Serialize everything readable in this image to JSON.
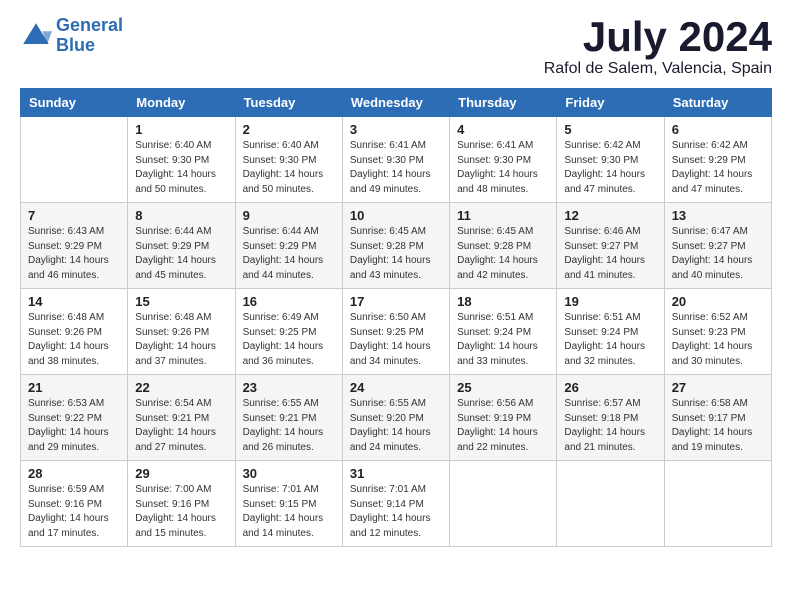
{
  "logo": {
    "line1": "General",
    "line2": "Blue"
  },
  "title": "July 2024",
  "location": "Rafol de Salem, Valencia, Spain",
  "days_of_week": [
    "Sunday",
    "Monday",
    "Tuesday",
    "Wednesday",
    "Thursday",
    "Friday",
    "Saturday"
  ],
  "weeks": [
    [
      {
        "day": "",
        "sunrise": "",
        "sunset": "",
        "daylight": ""
      },
      {
        "day": "1",
        "sunrise": "Sunrise: 6:40 AM",
        "sunset": "Sunset: 9:30 PM",
        "daylight": "Daylight: 14 hours and 50 minutes."
      },
      {
        "day": "2",
        "sunrise": "Sunrise: 6:40 AM",
        "sunset": "Sunset: 9:30 PM",
        "daylight": "Daylight: 14 hours and 50 minutes."
      },
      {
        "day": "3",
        "sunrise": "Sunrise: 6:41 AM",
        "sunset": "Sunset: 9:30 PM",
        "daylight": "Daylight: 14 hours and 49 minutes."
      },
      {
        "day": "4",
        "sunrise": "Sunrise: 6:41 AM",
        "sunset": "Sunset: 9:30 PM",
        "daylight": "Daylight: 14 hours and 48 minutes."
      },
      {
        "day": "5",
        "sunrise": "Sunrise: 6:42 AM",
        "sunset": "Sunset: 9:30 PM",
        "daylight": "Daylight: 14 hours and 47 minutes."
      },
      {
        "day": "6",
        "sunrise": "Sunrise: 6:42 AM",
        "sunset": "Sunset: 9:29 PM",
        "daylight": "Daylight: 14 hours and 47 minutes."
      }
    ],
    [
      {
        "day": "7",
        "sunrise": "Sunrise: 6:43 AM",
        "sunset": "Sunset: 9:29 PM",
        "daylight": "Daylight: 14 hours and 46 minutes."
      },
      {
        "day": "8",
        "sunrise": "Sunrise: 6:44 AM",
        "sunset": "Sunset: 9:29 PM",
        "daylight": "Daylight: 14 hours and 45 minutes."
      },
      {
        "day": "9",
        "sunrise": "Sunrise: 6:44 AM",
        "sunset": "Sunset: 9:29 PM",
        "daylight": "Daylight: 14 hours and 44 minutes."
      },
      {
        "day": "10",
        "sunrise": "Sunrise: 6:45 AM",
        "sunset": "Sunset: 9:28 PM",
        "daylight": "Daylight: 14 hours and 43 minutes."
      },
      {
        "day": "11",
        "sunrise": "Sunrise: 6:45 AM",
        "sunset": "Sunset: 9:28 PM",
        "daylight": "Daylight: 14 hours and 42 minutes."
      },
      {
        "day": "12",
        "sunrise": "Sunrise: 6:46 AM",
        "sunset": "Sunset: 9:27 PM",
        "daylight": "Daylight: 14 hours and 41 minutes."
      },
      {
        "day": "13",
        "sunrise": "Sunrise: 6:47 AM",
        "sunset": "Sunset: 9:27 PM",
        "daylight": "Daylight: 14 hours and 40 minutes."
      }
    ],
    [
      {
        "day": "14",
        "sunrise": "Sunrise: 6:48 AM",
        "sunset": "Sunset: 9:26 PM",
        "daylight": "Daylight: 14 hours and 38 minutes."
      },
      {
        "day": "15",
        "sunrise": "Sunrise: 6:48 AM",
        "sunset": "Sunset: 9:26 PM",
        "daylight": "Daylight: 14 hours and 37 minutes."
      },
      {
        "day": "16",
        "sunrise": "Sunrise: 6:49 AM",
        "sunset": "Sunset: 9:25 PM",
        "daylight": "Daylight: 14 hours and 36 minutes."
      },
      {
        "day": "17",
        "sunrise": "Sunrise: 6:50 AM",
        "sunset": "Sunset: 9:25 PM",
        "daylight": "Daylight: 14 hours and 34 minutes."
      },
      {
        "day": "18",
        "sunrise": "Sunrise: 6:51 AM",
        "sunset": "Sunset: 9:24 PM",
        "daylight": "Daylight: 14 hours and 33 minutes."
      },
      {
        "day": "19",
        "sunrise": "Sunrise: 6:51 AM",
        "sunset": "Sunset: 9:24 PM",
        "daylight": "Daylight: 14 hours and 32 minutes."
      },
      {
        "day": "20",
        "sunrise": "Sunrise: 6:52 AM",
        "sunset": "Sunset: 9:23 PM",
        "daylight": "Daylight: 14 hours and 30 minutes."
      }
    ],
    [
      {
        "day": "21",
        "sunrise": "Sunrise: 6:53 AM",
        "sunset": "Sunset: 9:22 PM",
        "daylight": "Daylight: 14 hours and 29 minutes."
      },
      {
        "day": "22",
        "sunrise": "Sunrise: 6:54 AM",
        "sunset": "Sunset: 9:21 PM",
        "daylight": "Daylight: 14 hours and 27 minutes."
      },
      {
        "day": "23",
        "sunrise": "Sunrise: 6:55 AM",
        "sunset": "Sunset: 9:21 PM",
        "daylight": "Daylight: 14 hours and 26 minutes."
      },
      {
        "day": "24",
        "sunrise": "Sunrise: 6:55 AM",
        "sunset": "Sunset: 9:20 PM",
        "daylight": "Daylight: 14 hours and 24 minutes."
      },
      {
        "day": "25",
        "sunrise": "Sunrise: 6:56 AM",
        "sunset": "Sunset: 9:19 PM",
        "daylight": "Daylight: 14 hours and 22 minutes."
      },
      {
        "day": "26",
        "sunrise": "Sunrise: 6:57 AM",
        "sunset": "Sunset: 9:18 PM",
        "daylight": "Daylight: 14 hours and 21 minutes."
      },
      {
        "day": "27",
        "sunrise": "Sunrise: 6:58 AM",
        "sunset": "Sunset: 9:17 PM",
        "daylight": "Daylight: 14 hours and 19 minutes."
      }
    ],
    [
      {
        "day": "28",
        "sunrise": "Sunrise: 6:59 AM",
        "sunset": "Sunset: 9:16 PM",
        "daylight": "Daylight: 14 hours and 17 minutes."
      },
      {
        "day": "29",
        "sunrise": "Sunrise: 7:00 AM",
        "sunset": "Sunset: 9:16 PM",
        "daylight": "Daylight: 14 hours and 15 minutes."
      },
      {
        "day": "30",
        "sunrise": "Sunrise: 7:01 AM",
        "sunset": "Sunset: 9:15 PM",
        "daylight": "Daylight: 14 hours and 14 minutes."
      },
      {
        "day": "31",
        "sunrise": "Sunrise: 7:01 AM",
        "sunset": "Sunset: 9:14 PM",
        "daylight": "Daylight: 14 hours and 12 minutes."
      },
      {
        "day": "",
        "sunrise": "",
        "sunset": "",
        "daylight": ""
      },
      {
        "day": "",
        "sunrise": "",
        "sunset": "",
        "daylight": ""
      },
      {
        "day": "",
        "sunrise": "",
        "sunset": "",
        "daylight": ""
      }
    ]
  ]
}
